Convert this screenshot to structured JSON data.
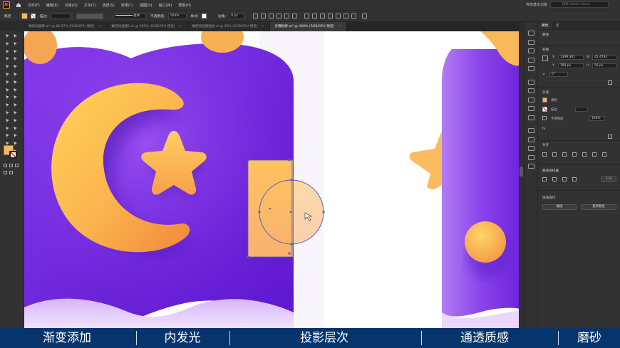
{
  "menubar": {
    "logo": "Ai",
    "items": [
      "文件(F)",
      "编辑(E)",
      "对象(O)",
      "文字(T)",
      "选择(S)",
      "效果(C)",
      "视图(V)",
      "窗口(W)",
      "帮助(H)"
    ],
    "workspace": "传统基本功能",
    "search_placeholder": "搜索 Adobe Stock"
  },
  "controlbar": {
    "path_label": "路径",
    "stroke_label": "描边:",
    "stroke_style": "基本",
    "opacity_label": "不透明度:",
    "opacity_value": "100%",
    "style_label": "样式:",
    "corner_label": "边角:",
    "corner_value": "0 px"
  },
  "tabs": [
    {
      "label": "睡前绘画版.ai* @ 66.67% (RGB/GPU 预览)",
      "active": false
    },
    {
      "label": "睡前绘画版2.ai @ 150% (RGB/GPU 预览)",
      "active": false
    },
    {
      "label": "睡前绘画版图标.ai @ 25% (RGB/GPU 预览)",
      "active": false
    },
    {
      "label": "步骤拆解.ai* @ 400% (RGB/GPU 预览)",
      "active": true
    }
  ],
  "properties": {
    "tabs": [
      "属性",
      "库"
    ],
    "section_transform": "变换",
    "x_value": "1299.361",
    "w_value": "45.4783",
    "y_value": "189 px",
    "h_value": "59 px",
    "angle_value": "0°",
    "section_appearance": "外观",
    "fill_label": "填色",
    "stroke_label": "描边",
    "opacity_label": "不透明度",
    "opacity_value": "100%",
    "fx_label": "fx.",
    "section_align": "对齐",
    "section_pathfinder": "路径查找器",
    "expand_button": "扩展",
    "section_quick": "快速操作",
    "edit_button": "编组",
    "recolor_button": "重新着色"
  },
  "subtitles": [
    "渐变添加",
    "内发光",
    "投影层次",
    "通透质感",
    "磨砂"
  ],
  "colors": {
    "subtitle_bg": "#06356e",
    "purple_dark": "#6a1fd6",
    "purple_light": "#b57cf0",
    "orange": "#f59a3c",
    "yellow": "#ffd15c",
    "selection_blue": "#5560b8"
  }
}
